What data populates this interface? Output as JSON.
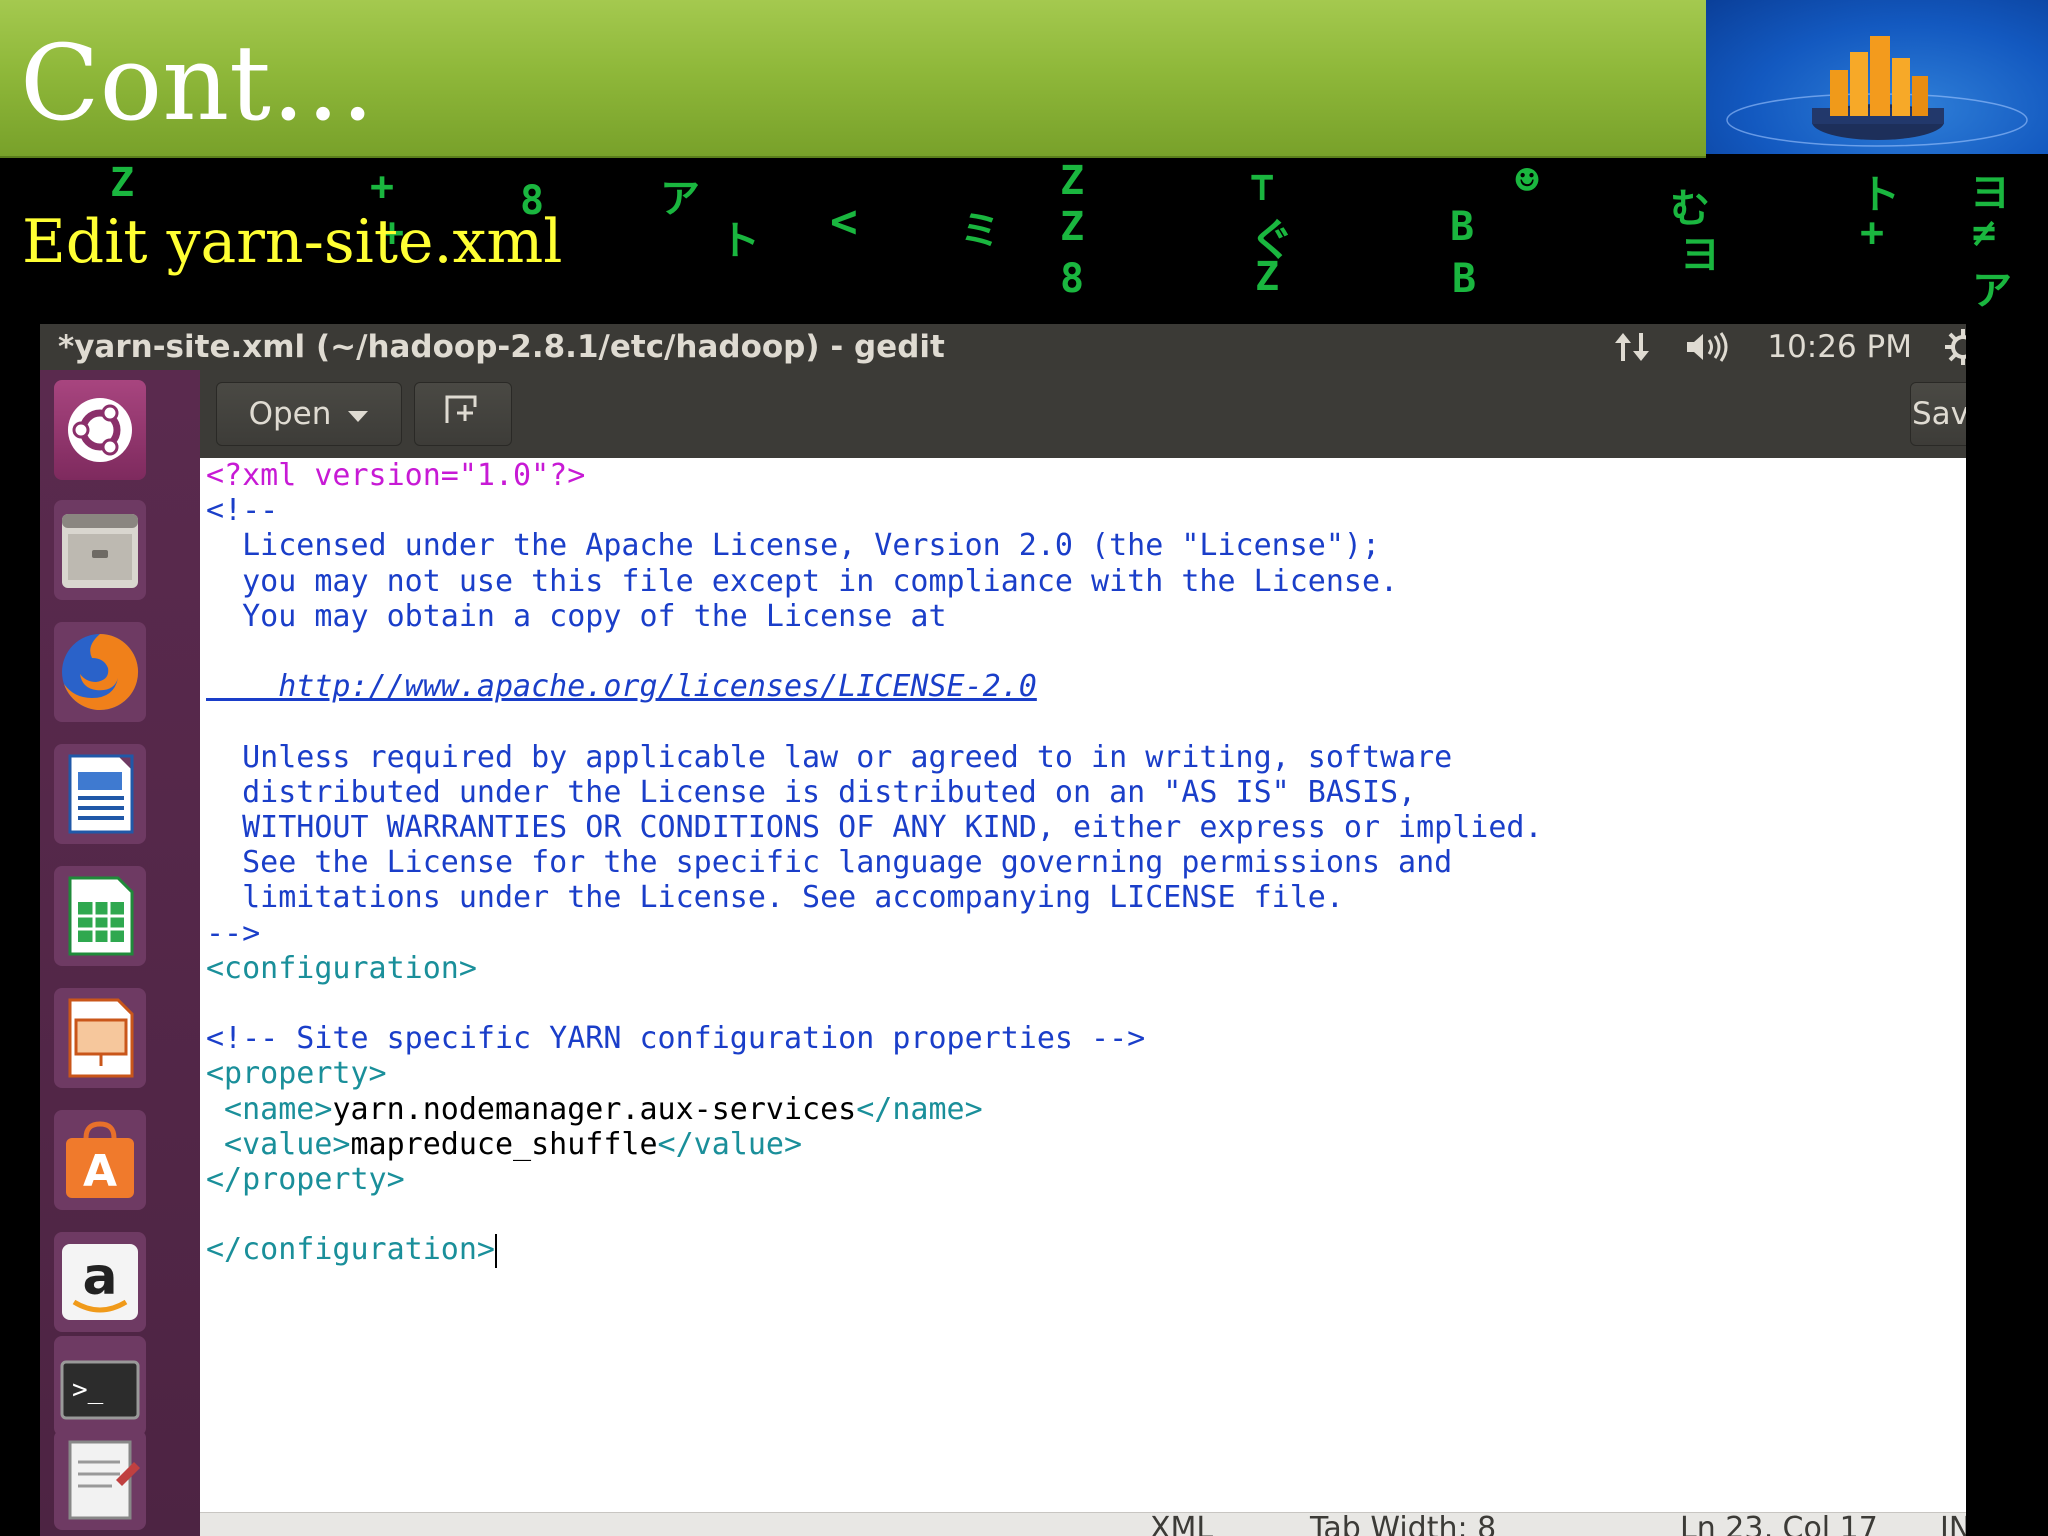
{
  "slide": {
    "title": "Cont…",
    "subtitle": "Edit yarn-site.xml"
  },
  "window": {
    "title": "*yarn-site.xml (~/hadoop-2.8.1/etc/hadoop) - gedit",
    "clock": "10:26 PM",
    "network_icon": "network-updown-icon",
    "volume_icon": "volume-icon",
    "settings_icon": "gear-icon"
  },
  "launcher": {
    "items": [
      "ubuntu-dash-icon",
      "files-icon",
      "firefox-icon",
      "writer-icon",
      "calc-icon",
      "impress-icon",
      "software-center-icon",
      "amazon-icon",
      "terminal-icon",
      "text-editor-icon"
    ]
  },
  "toolbar": {
    "open_label": "Open",
    "new_tab_icon": "new-document-icon",
    "save_label": "Save"
  },
  "editor": {
    "lines": {
      "l1": "<?xml version=\"1.0\"?>",
      "l2": "<!--",
      "l3": "  Licensed under the Apache License, Version 2.0 (the \"License\");",
      "l4": "  you may not use this file except in compliance with the License.",
      "l5": "  You may obtain a copy of the License at",
      "l7": "    http://www.apache.org/licenses/LICENSE-2.0",
      "l9": "  Unless required by applicable law or agreed to in writing, software",
      "l10": "  distributed under the License is distributed on an \"AS IS\" BASIS,",
      "l11": "  WITHOUT WARRANTIES OR CONDITIONS OF ANY KIND, either express or implied.",
      "l12": "  See the License for the specific language governing permissions and",
      "l13": "  limitations under the License. See accompanying LICENSE file.",
      "l14": "-->",
      "l15": "<configuration>",
      "l17": "<!-- Site specific YARN configuration properties -->",
      "l18": "<property>",
      "l19_open": " <name>",
      "l19_text": "yarn.nodemanager.aux-services",
      "l19_close": "</name>",
      "l20_open": " <value>",
      "l20_text": "mapreduce_shuffle",
      "l20_close": "</value>",
      "l21": "</property>",
      "l23": "</configuration>"
    }
  },
  "statusbar": {
    "language": "XML",
    "tab_width": "Tab Width: 8",
    "position": "Ln 23, Col 17",
    "mode": "INS"
  },
  "colors": {
    "slide_green": "#8fb83a",
    "subtitle_yellow": "#ffff33",
    "launcher_purple": "#4d2443",
    "xml_pi": "#c71ad5",
    "xml_comment": "#1a3ec9",
    "xml_tag": "#1a8f9a"
  }
}
